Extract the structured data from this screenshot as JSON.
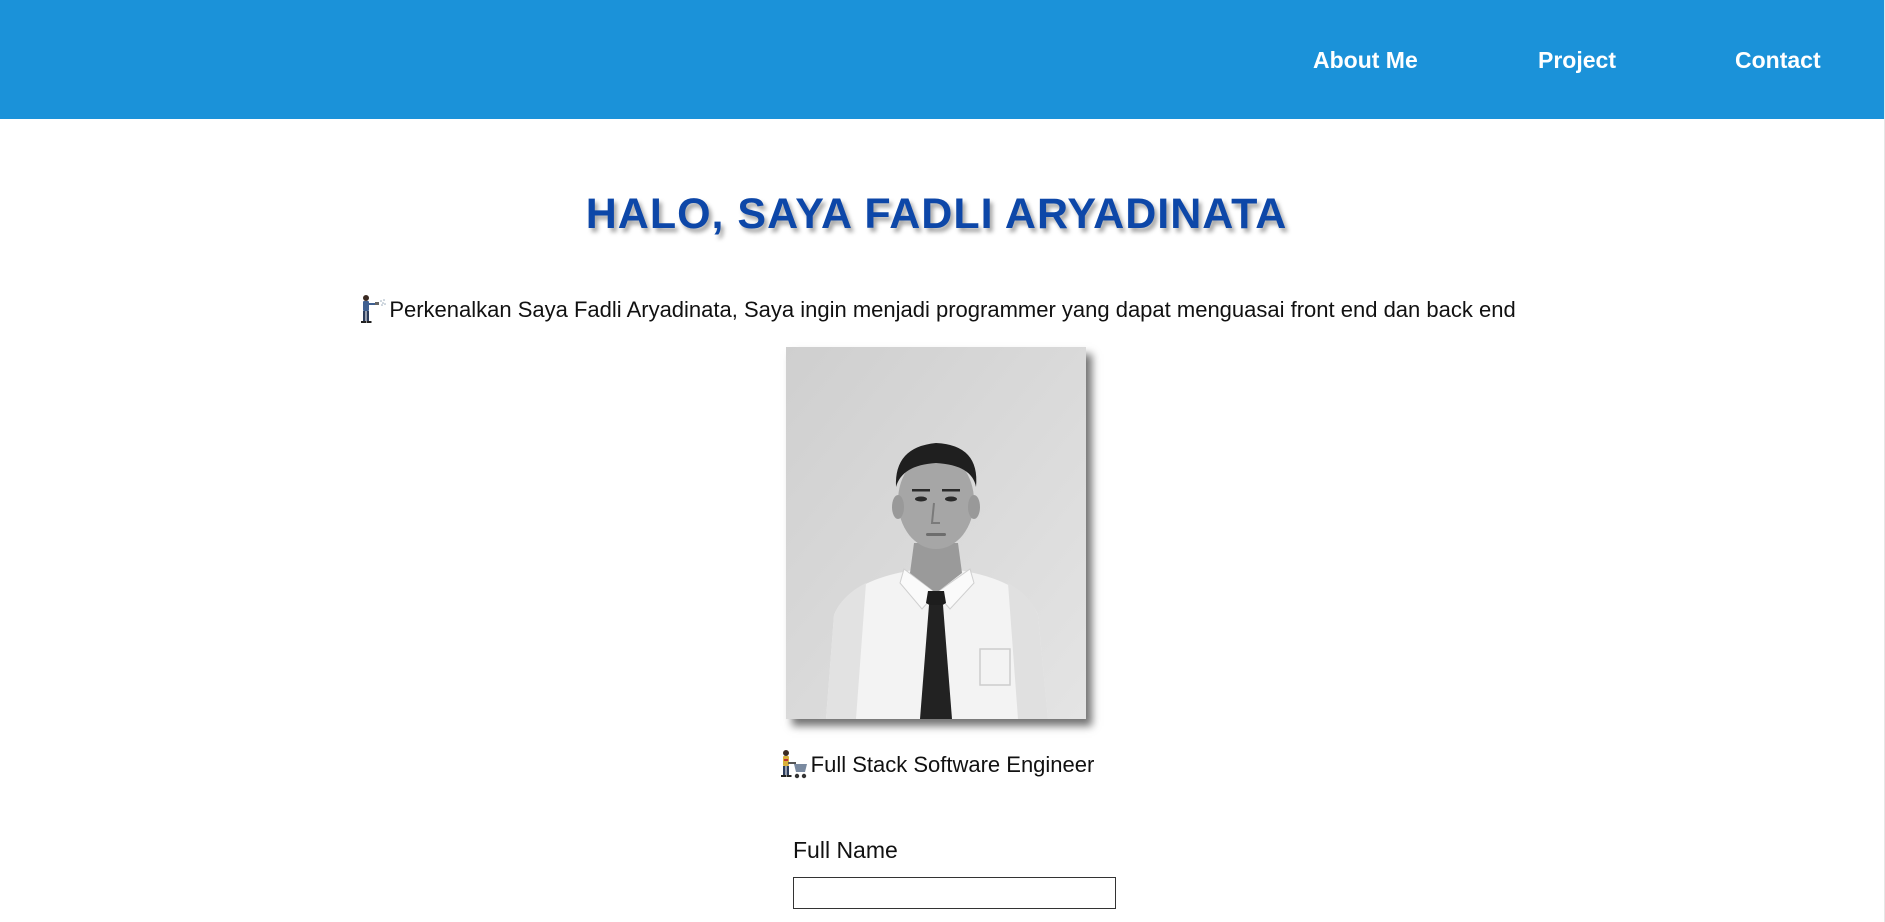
{
  "nav": {
    "items": [
      {
        "label": "About Me"
      },
      {
        "label": "Project"
      },
      {
        "label": "Contact"
      }
    ],
    "background_color": "#1b92d9"
  },
  "hero": {
    "heading": "HALO, SAYA FADLI ARYADINATA",
    "heading_color": "#0d47a8",
    "intro_icon": "person-spraying-icon",
    "intro_text": "Perkenalkan Saya Fadli Aryadinata, Saya ingin menjadi programmer yang dapat menguasai front end dan back end"
  },
  "profile": {
    "photo": "grayscale-portrait-photo",
    "role_icon": "worker-with-cart-icon",
    "role_text": "Full Stack Software Engineer"
  },
  "form": {
    "full_name_label": "Full Name",
    "full_name_value": "",
    "full_name_placeholder": ""
  }
}
